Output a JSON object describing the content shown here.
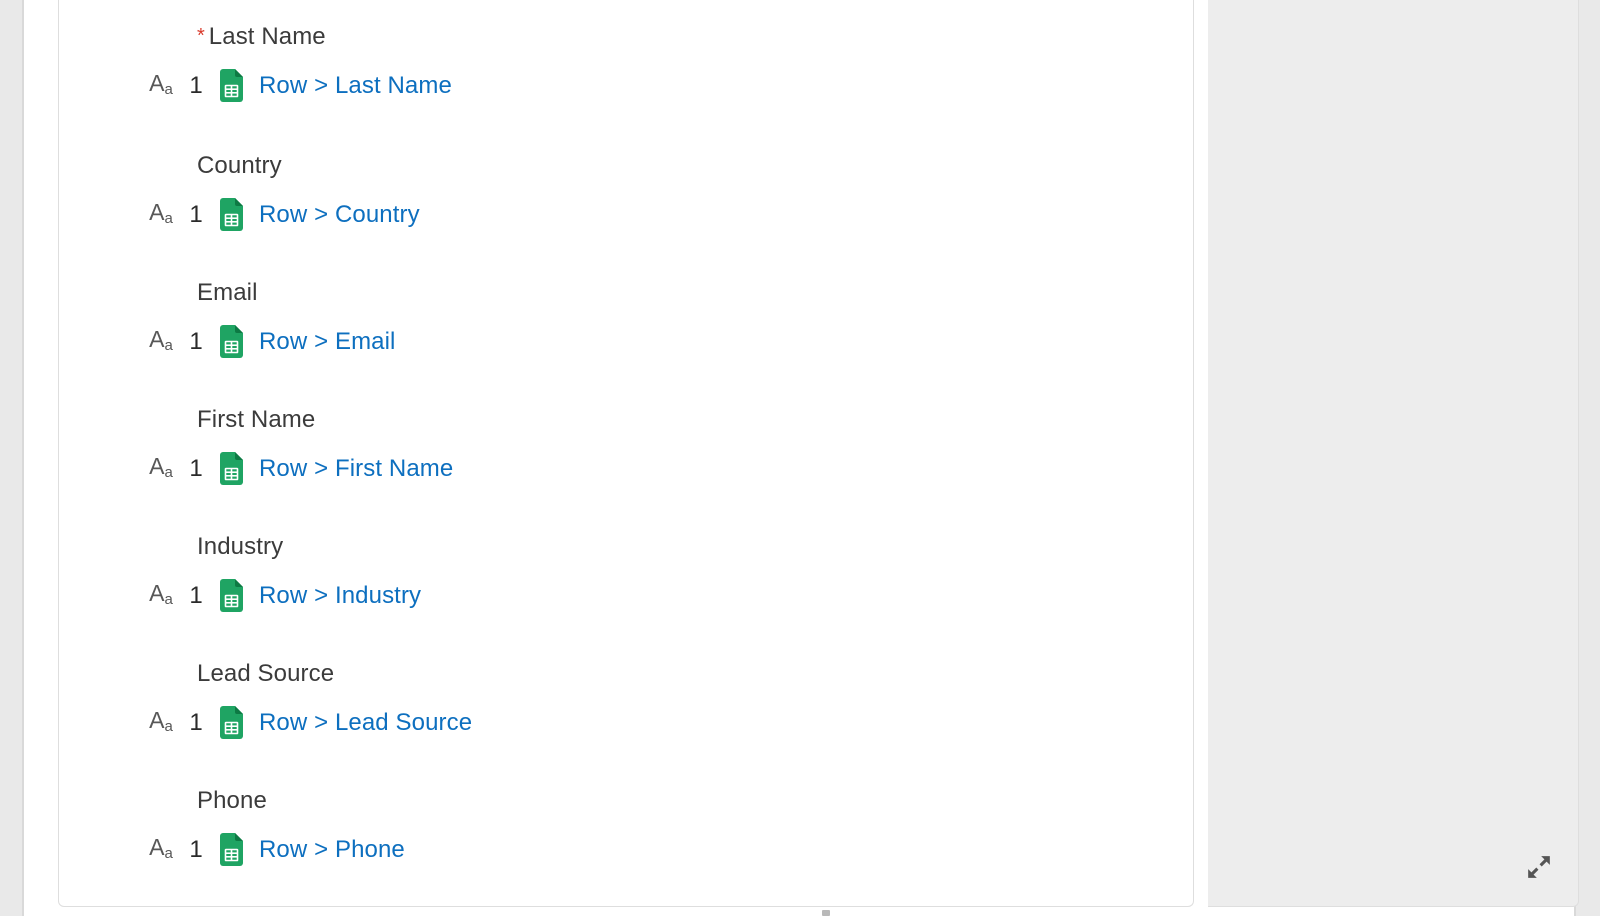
{
  "step_number": "1",
  "fields": [
    {
      "label": "Last Name",
      "required": true,
      "mapping": "Row > Last Name"
    },
    {
      "label": "Country",
      "required": false,
      "mapping": "Row > Country"
    },
    {
      "label": "Email",
      "required": false,
      "mapping": "Row > Email"
    },
    {
      "label": "First Name",
      "required": false,
      "mapping": "Row > First Name"
    },
    {
      "label": "Industry",
      "required": false,
      "mapping": "Row > Industry"
    },
    {
      "label": "Lead Source",
      "required": false,
      "mapping": "Row > Lead Source"
    },
    {
      "label": "Phone",
      "required": false,
      "mapping": "Row > Phone"
    }
  ],
  "required_marker": "*",
  "icons": {
    "text_type": "Aa",
    "source": "google-sheets",
    "expand": "expand"
  },
  "colors": {
    "link": "#0d6fbf",
    "required": "#d93a2b",
    "sheets_green": "#1fa463",
    "panel_bg": "#ffffff",
    "side_bg": "#ededed",
    "page_bg": "#e9e9e9"
  }
}
